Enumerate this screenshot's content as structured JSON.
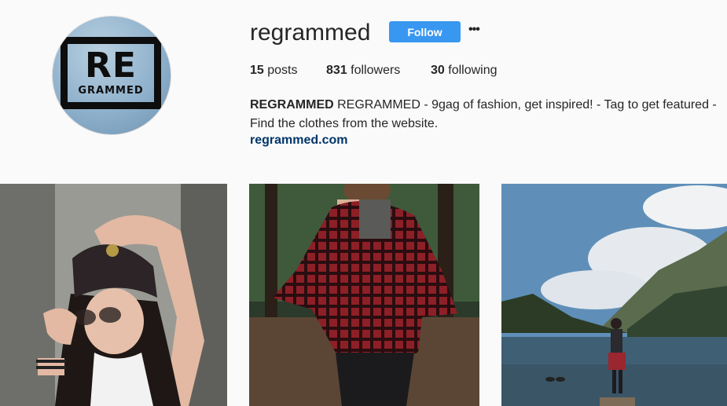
{
  "profile": {
    "username": "regrammed",
    "follow_label": "Follow",
    "more_label": "•••",
    "avatar_logo": {
      "line1": "RE",
      "line2": "GRAMMED"
    },
    "stats": {
      "posts_count": "15",
      "posts_label": "posts",
      "followers_count": "831",
      "followers_label": "followers",
      "following_count": "30",
      "following_label": "following"
    },
    "bio": {
      "name": "REGRAMMED",
      "text": "REGRAMMED - 9gag of fashion, get inspired! - Tag to get featured - Find the clothes from the website.",
      "website": "regrammed.com"
    }
  },
  "colors": {
    "follow_blue": "#3897f0",
    "link_dark": "#003569",
    "background": "#fafafa"
  },
  "posts": [
    {
      "subject": "woman-beanie-sunglasses"
    },
    {
      "subject": "woman-plaid-shirt-forest"
    },
    {
      "subject": "woman-lake-mountains"
    }
  ]
}
